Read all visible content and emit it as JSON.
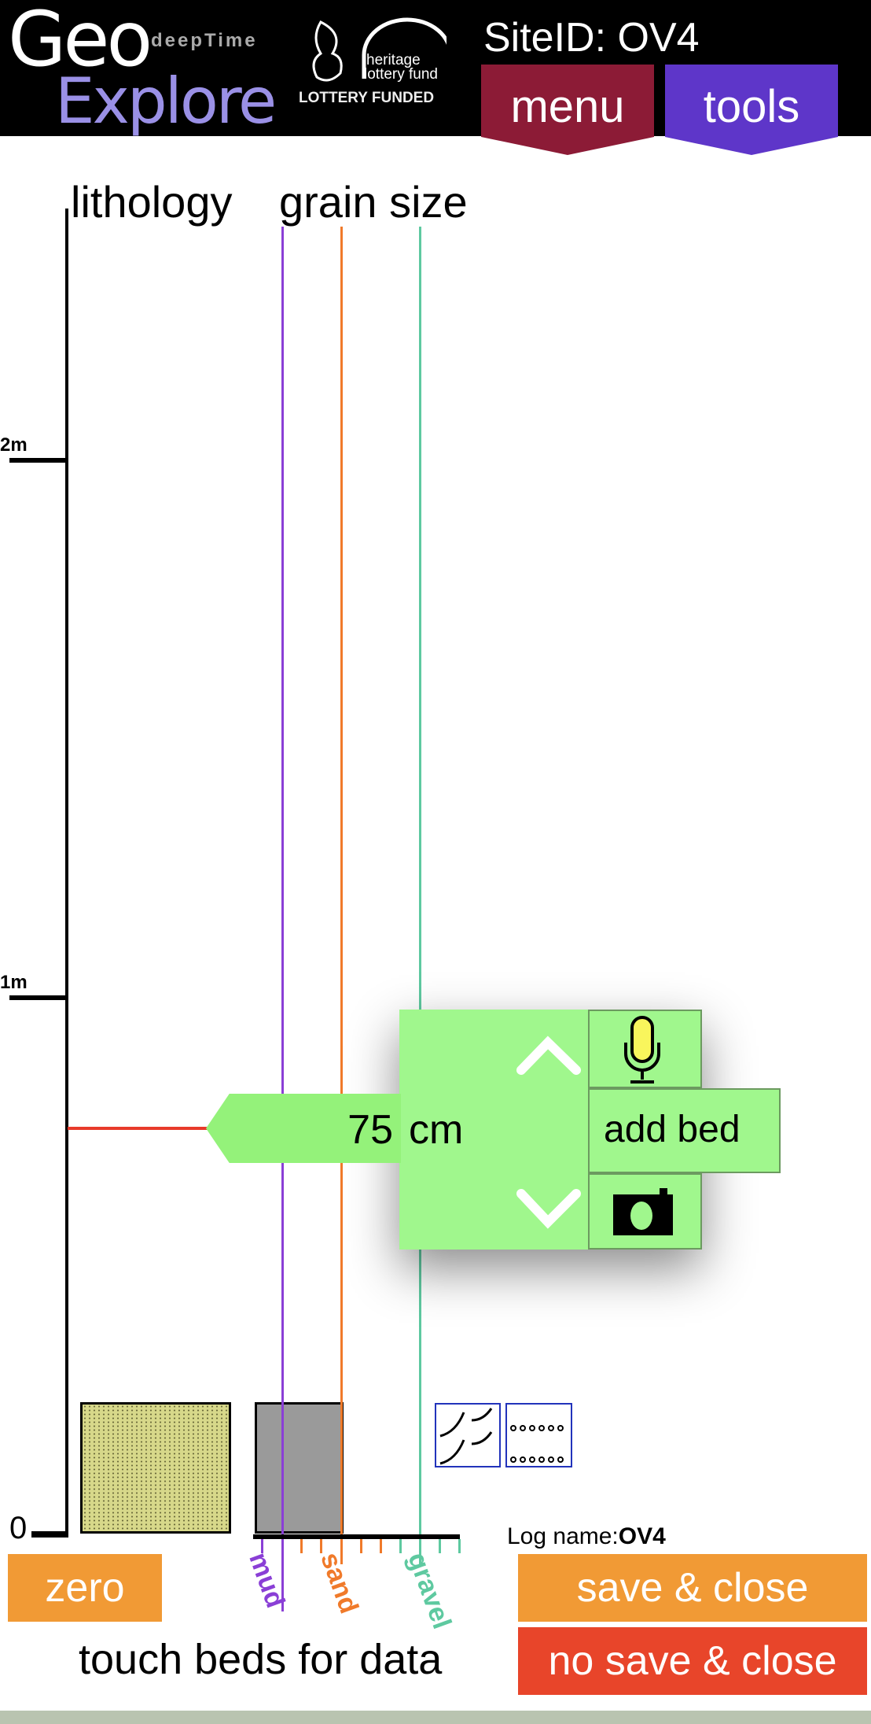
{
  "header": {
    "logo_geo": "Geo",
    "logo_explore": "Explore",
    "logo_deeptime": "deepTime",
    "lottery_heritage": "heritage lottery fund",
    "lottery_funded": "LOTTERY FUNDED",
    "site_id": "SiteID: OV4",
    "menu_label": "menu",
    "tools_label": "tools"
  },
  "log": {
    "lithology_header": "lithology",
    "grain_size_header": "grain size",
    "scale_labels": [
      "2m",
      "1m",
      "0"
    ],
    "grain_labels": [
      "mud",
      "sand",
      "gravel"
    ],
    "log_name_label": "Log name:",
    "log_name_value": "OV4",
    "hint": "touch beds for data"
  },
  "bed_editor": {
    "value": "75",
    "unit": "cm",
    "add_bed_label": "add bed",
    "icons": [
      "chevron-up-icon",
      "chevron-down-icon",
      "microphone-icon",
      "camera-icon"
    ]
  },
  "buttons": {
    "zero": "zero",
    "save_close": "save & close",
    "no_save_close": "no save & close"
  },
  "colors": {
    "mud": "#8a3fd6",
    "sand": "#f07a2a",
    "gravel": "#5ec9a0",
    "menu": "#8c1b36",
    "tools": "#5e36c9",
    "editor": "#a0f78d",
    "save": "#f19a35",
    "no_save": "#e8452a",
    "marker": "#e83a2a"
  }
}
